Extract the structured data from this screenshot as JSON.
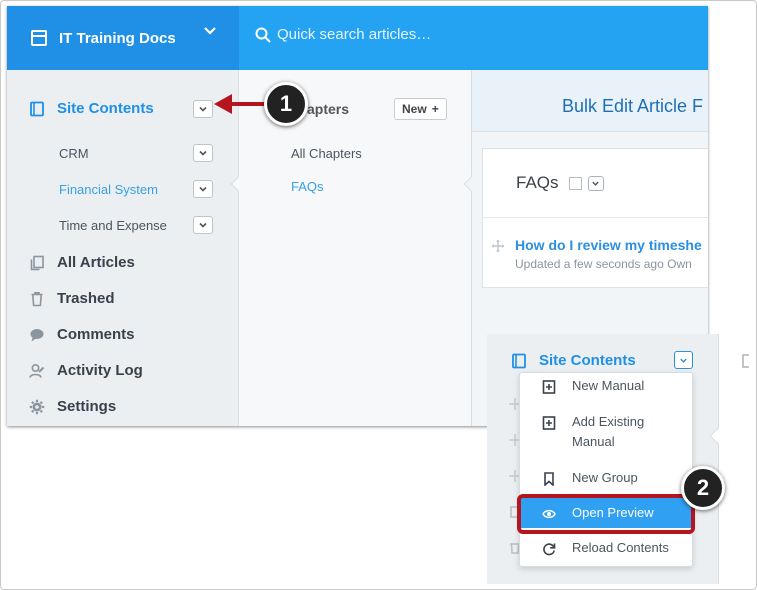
{
  "app": {
    "project_title": "IT Training Docs",
    "search_placeholder": "Quick search articles…"
  },
  "sidebar": {
    "site_contents": "Site Contents",
    "sub_items": [
      "CRM",
      "Financial System",
      "Time and Expense"
    ],
    "nav": [
      "All Articles",
      "Trashed",
      "Comments",
      "Activity Log",
      "Settings"
    ]
  },
  "chapters": {
    "header": "Chapters",
    "header_visible": "apters",
    "new_label": "New",
    "items": [
      "All Chapters",
      "FAQs"
    ]
  },
  "content": {
    "page_title": "Bulk Edit Article F",
    "section": "FAQs",
    "article_title": "How do I review my timeshe",
    "article_meta": "Updated a few seconds ago  Own"
  },
  "callouts": {
    "step1": "1",
    "step2": "2"
  },
  "dropdown_menu": {
    "site_contents": "Site Contents",
    "items": [
      {
        "label": "New Manual",
        "icon": "book-plus-icon"
      },
      {
        "label": "Add Existing Manual",
        "line1": "Add Existing",
        "line2": "Manual",
        "icon": "book-plus-icon"
      },
      {
        "label": "New Group",
        "icon": "bookmark-icon"
      },
      {
        "label": "Open Preview",
        "icon": "eye-icon",
        "highlighted": true
      },
      {
        "label": "Reload Contents",
        "icon": "refresh-icon"
      }
    ]
  },
  "colors": {
    "topbar": "#24a3f2",
    "accent": "#1f90e6",
    "callout_red": "#b3161d"
  }
}
